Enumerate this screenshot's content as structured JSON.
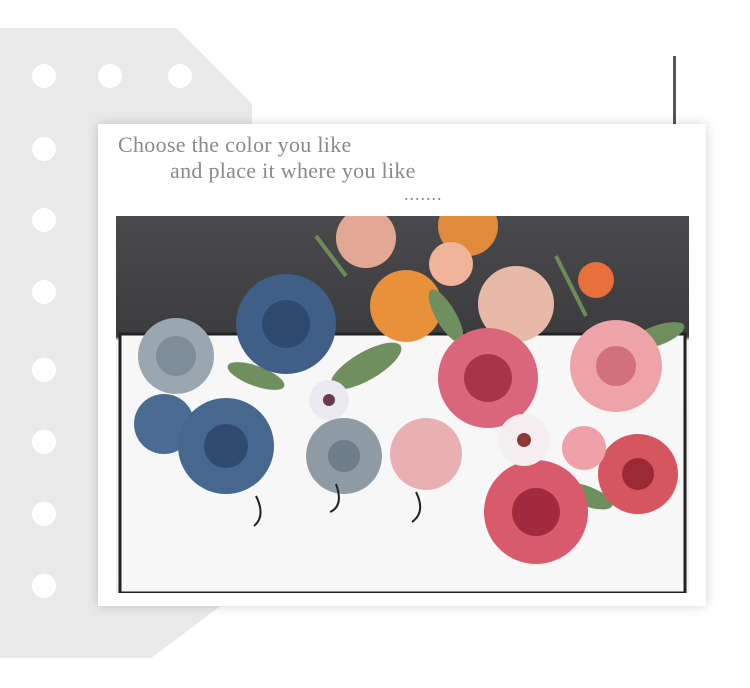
{
  "headline": {
    "line1": "Choose the color you like",
    "line2": "and place it where you like",
    "ellipsis": "......."
  },
  "colors": {
    "background_shape": "#e9e9e9",
    "text": "#8a8a8a",
    "accent_line": "#555555",
    "blue_flowers": "#3f5f86",
    "pink_flowers": "#d9667a",
    "orange_flowers": "#e8913a"
  }
}
